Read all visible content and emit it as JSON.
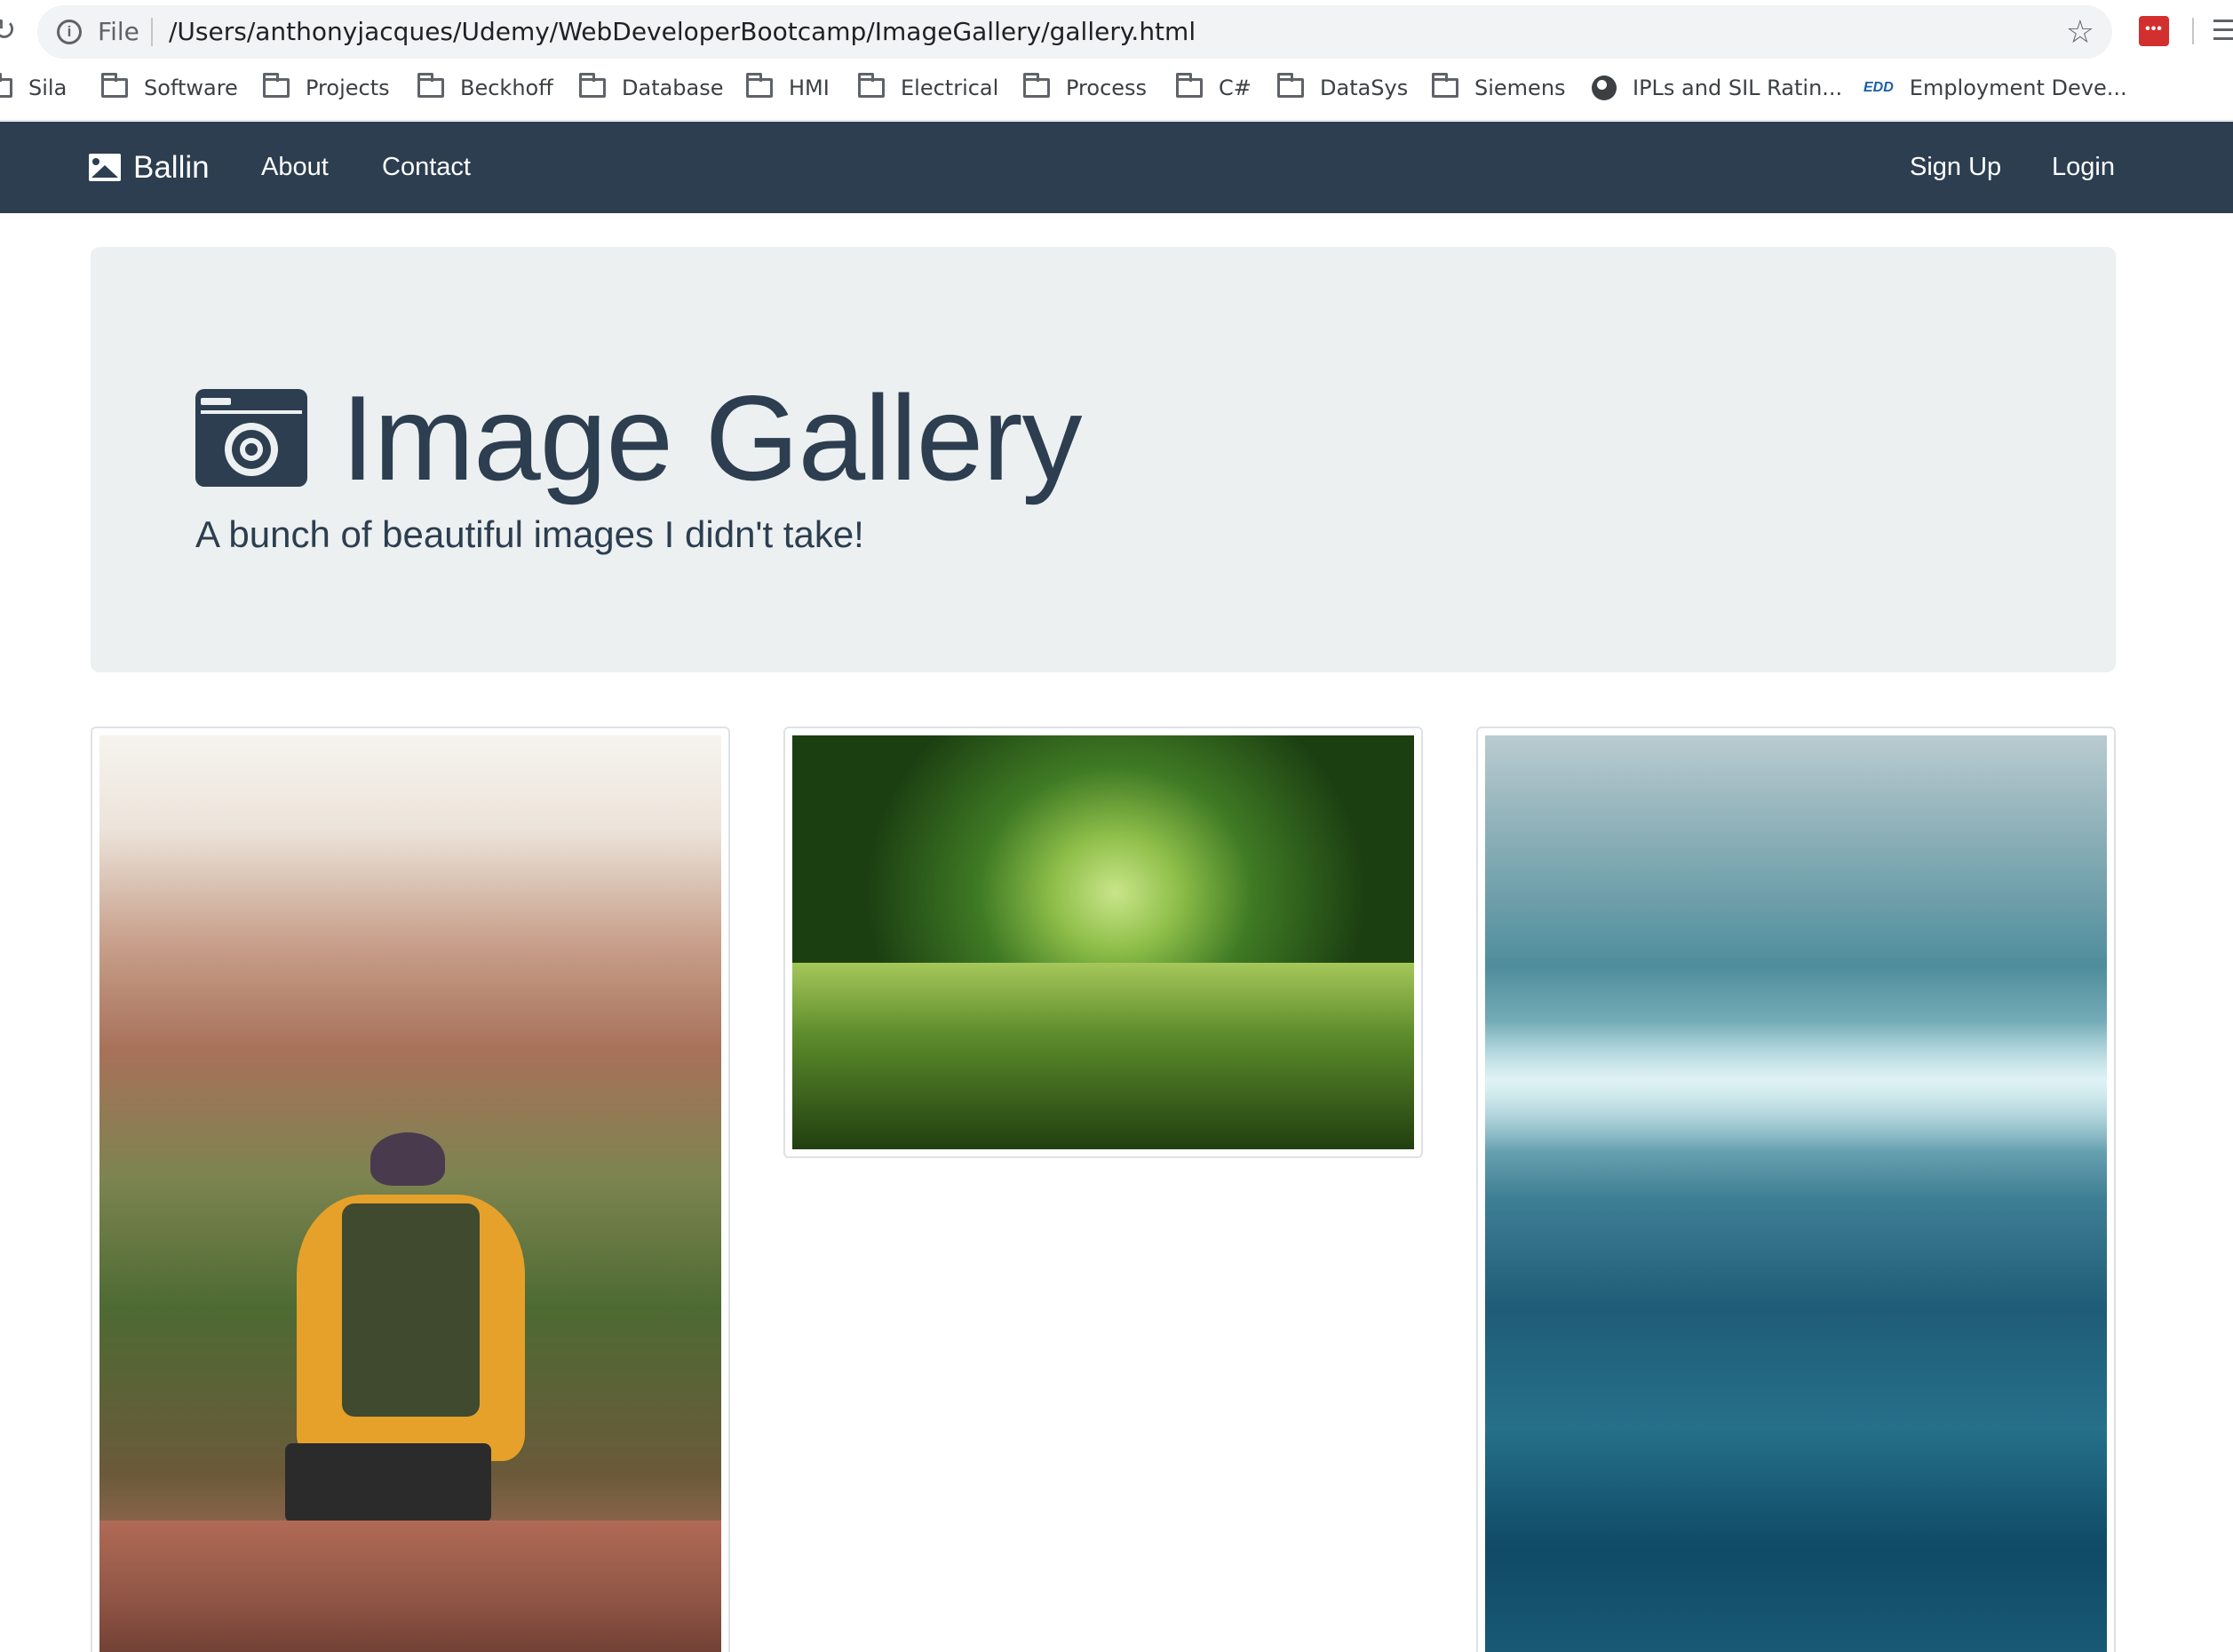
{
  "browser": {
    "file_label": "File",
    "url": "/Users/anthonyjacques/Udemy/WebDeveloperBootcamp/ImageGallery/gallery.html",
    "bookmarks": [
      {
        "label": "Sila",
        "icon": "folder-icon"
      },
      {
        "label": "Software",
        "icon": "folder-icon"
      },
      {
        "label": "Projects",
        "icon": "folder-icon"
      },
      {
        "label": "Beckhoff",
        "icon": "folder-icon"
      },
      {
        "label": "Database",
        "icon": "folder-icon"
      },
      {
        "label": "HMI",
        "icon": "folder-icon"
      },
      {
        "label": "Electrical",
        "icon": "folder-icon"
      },
      {
        "label": "Process",
        "icon": "folder-icon"
      },
      {
        "label": "C#",
        "icon": "folder-icon"
      },
      {
        "label": "DataSys",
        "icon": "folder-icon"
      },
      {
        "label": "Siemens",
        "icon": "folder-icon"
      },
      {
        "label": "IPLs and SIL Ratin...",
        "icon": "globe-icon"
      },
      {
        "label": "Employment Deve...",
        "icon": "edd-icon",
        "icon_text": "EDD"
      }
    ]
  },
  "navbar": {
    "brand": "Ballin",
    "links_left": [
      "About",
      "Contact"
    ],
    "links_right": [
      "Sign Up",
      "Login"
    ],
    "background": "#2c3e50"
  },
  "jumbotron": {
    "title": "Image Gallery",
    "subtitle": "A bunch of beautiful images I didn't take!",
    "background": "#ecf0f1",
    "text_color": "#2c3e50"
  },
  "gallery": {
    "images": [
      {
        "name": "hiker-image"
      },
      {
        "name": "forest-river-image"
      },
      {
        "name": "ocean-waves-image"
      }
    ]
  }
}
